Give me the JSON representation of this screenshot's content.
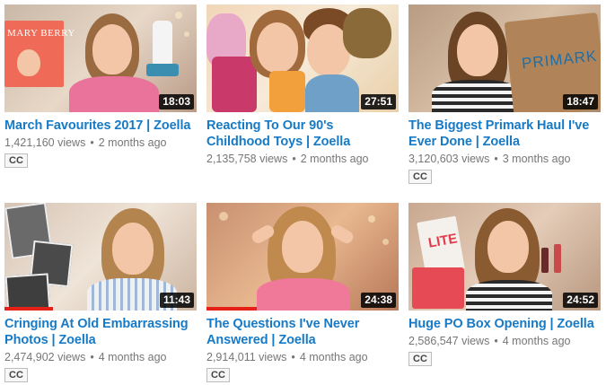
{
  "videos": [
    {
      "title": "March Favourites 2017 | Zoella",
      "views": "1,421,160 views",
      "age": "2 months ago",
      "duration": "18:03",
      "badge": "CC",
      "thumb_text": "MARY BERRY"
    },
    {
      "title": "Reacting To Our 90's Childhood Toys | Zoella",
      "views": "2,135,758 views",
      "age": "2 months ago",
      "duration": "27:51",
      "badge": ""
    },
    {
      "title": "The Biggest Primark Haul I've Ever Done | Zoella",
      "views": "3,120,603 views",
      "age": "3 months ago",
      "duration": "18:47",
      "badge": "CC",
      "thumb_text": "PRIMARK"
    },
    {
      "title": "Cringing At Old Embarrassing Photos | Zoella",
      "views": "2,474,902 views",
      "age": "4 months ago",
      "duration": "11:43",
      "badge": "CC",
      "watched": 0.25
    },
    {
      "title": "The Questions I've Never Answered | Zoella",
      "views": "2,914,011 views",
      "age": "4 months ago",
      "duration": "24:38",
      "badge": "CC",
      "watched": 0.26
    },
    {
      "title": "Huge PO Box Opening | Zoella",
      "views": "2,586,547 views",
      "age": "4 months ago",
      "duration": "24:52",
      "badge": "CC",
      "thumb_text": "LITE"
    }
  ],
  "meta_separator": "•"
}
